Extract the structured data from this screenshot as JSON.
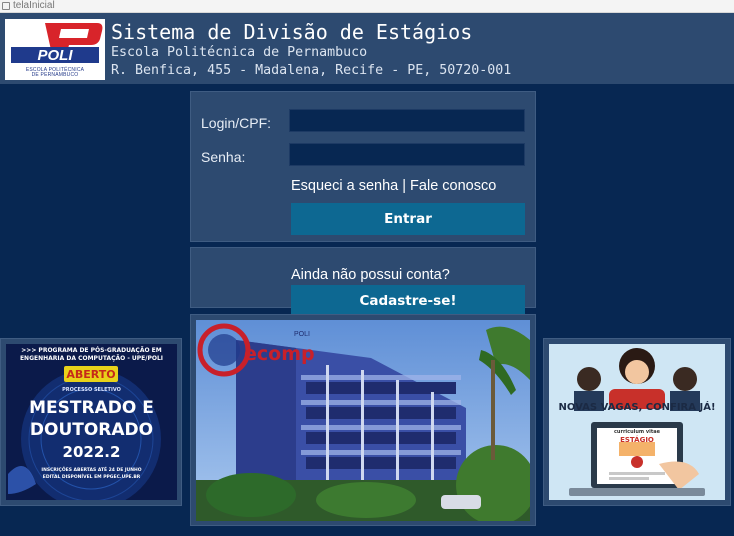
{
  "window": {
    "title": "telaInicial"
  },
  "header": {
    "logo_text": "POLI",
    "logo_sub_line1": "ESCOLA POLITÉCNICA",
    "logo_sub_line2": "DE PERNAMBUCO",
    "title": "Sistema de Divisão de Estágios",
    "subtitle": "Escola Politécnica de Pernambuco",
    "address": "R. Benfica, 455 - Madalena, Recife - PE, 50720-001"
  },
  "login": {
    "login_label": "Login/CPF:",
    "login_value": "",
    "password_label": "Senha:",
    "password_value": "",
    "forgot_link": "Esqueci a senha",
    "separator": " | ",
    "contact_link": "Fale conosco",
    "submit_label": "Entrar"
  },
  "signup": {
    "prompt": "Ainda não possui conta?",
    "button_label": "Cadastre-se!"
  },
  "ads": {
    "left": {
      "line1": ">>> PROGRAMA DE PÓS-GRADUAÇÃO EM",
      "line2": "ENGENHARIA DA COMPUTAÇÃO - UPE/POLI",
      "badge": "ABERTO",
      "selection": "PROCESSO SELETIVO",
      "main1": "MESTRADO E",
      "main2": "DOUTORADO",
      "term": "2022.2",
      "foot1": "INSCRIÇÕES ABERTAS ATÉ 24 DE JUNHO",
      "foot2": "EDITAL DISPONÍVEL EM PPGEC.UPE.BR"
    },
    "right": {
      "headline": "NOVAS VAGAS, CONFIRA JÁ!",
      "cv_label": "curriculum vitae",
      "cv_title": "ESTÁGIO"
    }
  },
  "photo": {
    "logo_text": "ecomp",
    "logo_top": "POLI"
  },
  "colors": {
    "background": "#072752",
    "panel": "#2d4a70",
    "button": "#0d6892",
    "input": "#072752"
  }
}
